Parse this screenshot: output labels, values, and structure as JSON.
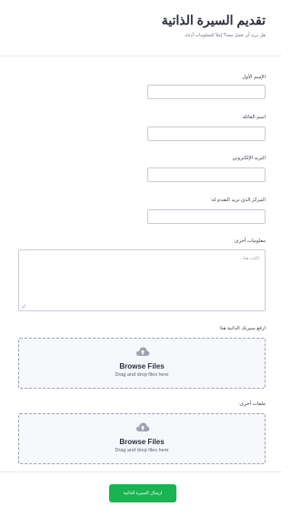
{
  "header": {
    "title": "تقديم السيرة الذاتية",
    "subtitle": "هل تريد أن تعمل معنا؟ إملأ المعلومات أدناه."
  },
  "form": {
    "first_name_label": "الإسم الأول",
    "family_name_label": "اسم العائلة",
    "email_label": "البريد الإلكتروني",
    "position_label": "المركز الذي تريد التقدم له:",
    "other_info_label": "معلومات أخرى:",
    "other_info_placeholder": "اكتب هنا...",
    "cv_upload_label": "ارفع سيرتك الذاتية هنا:",
    "other_files_label": "ملفات أخرى:"
  },
  "upload": {
    "browse_label": "Browse Files",
    "drag_text": "Drag and drop files here",
    "icon": "cloud-upload-icon"
  },
  "submit": {
    "label": "ارسال السيرة الذاتية",
    "color": "#18b451"
  }
}
